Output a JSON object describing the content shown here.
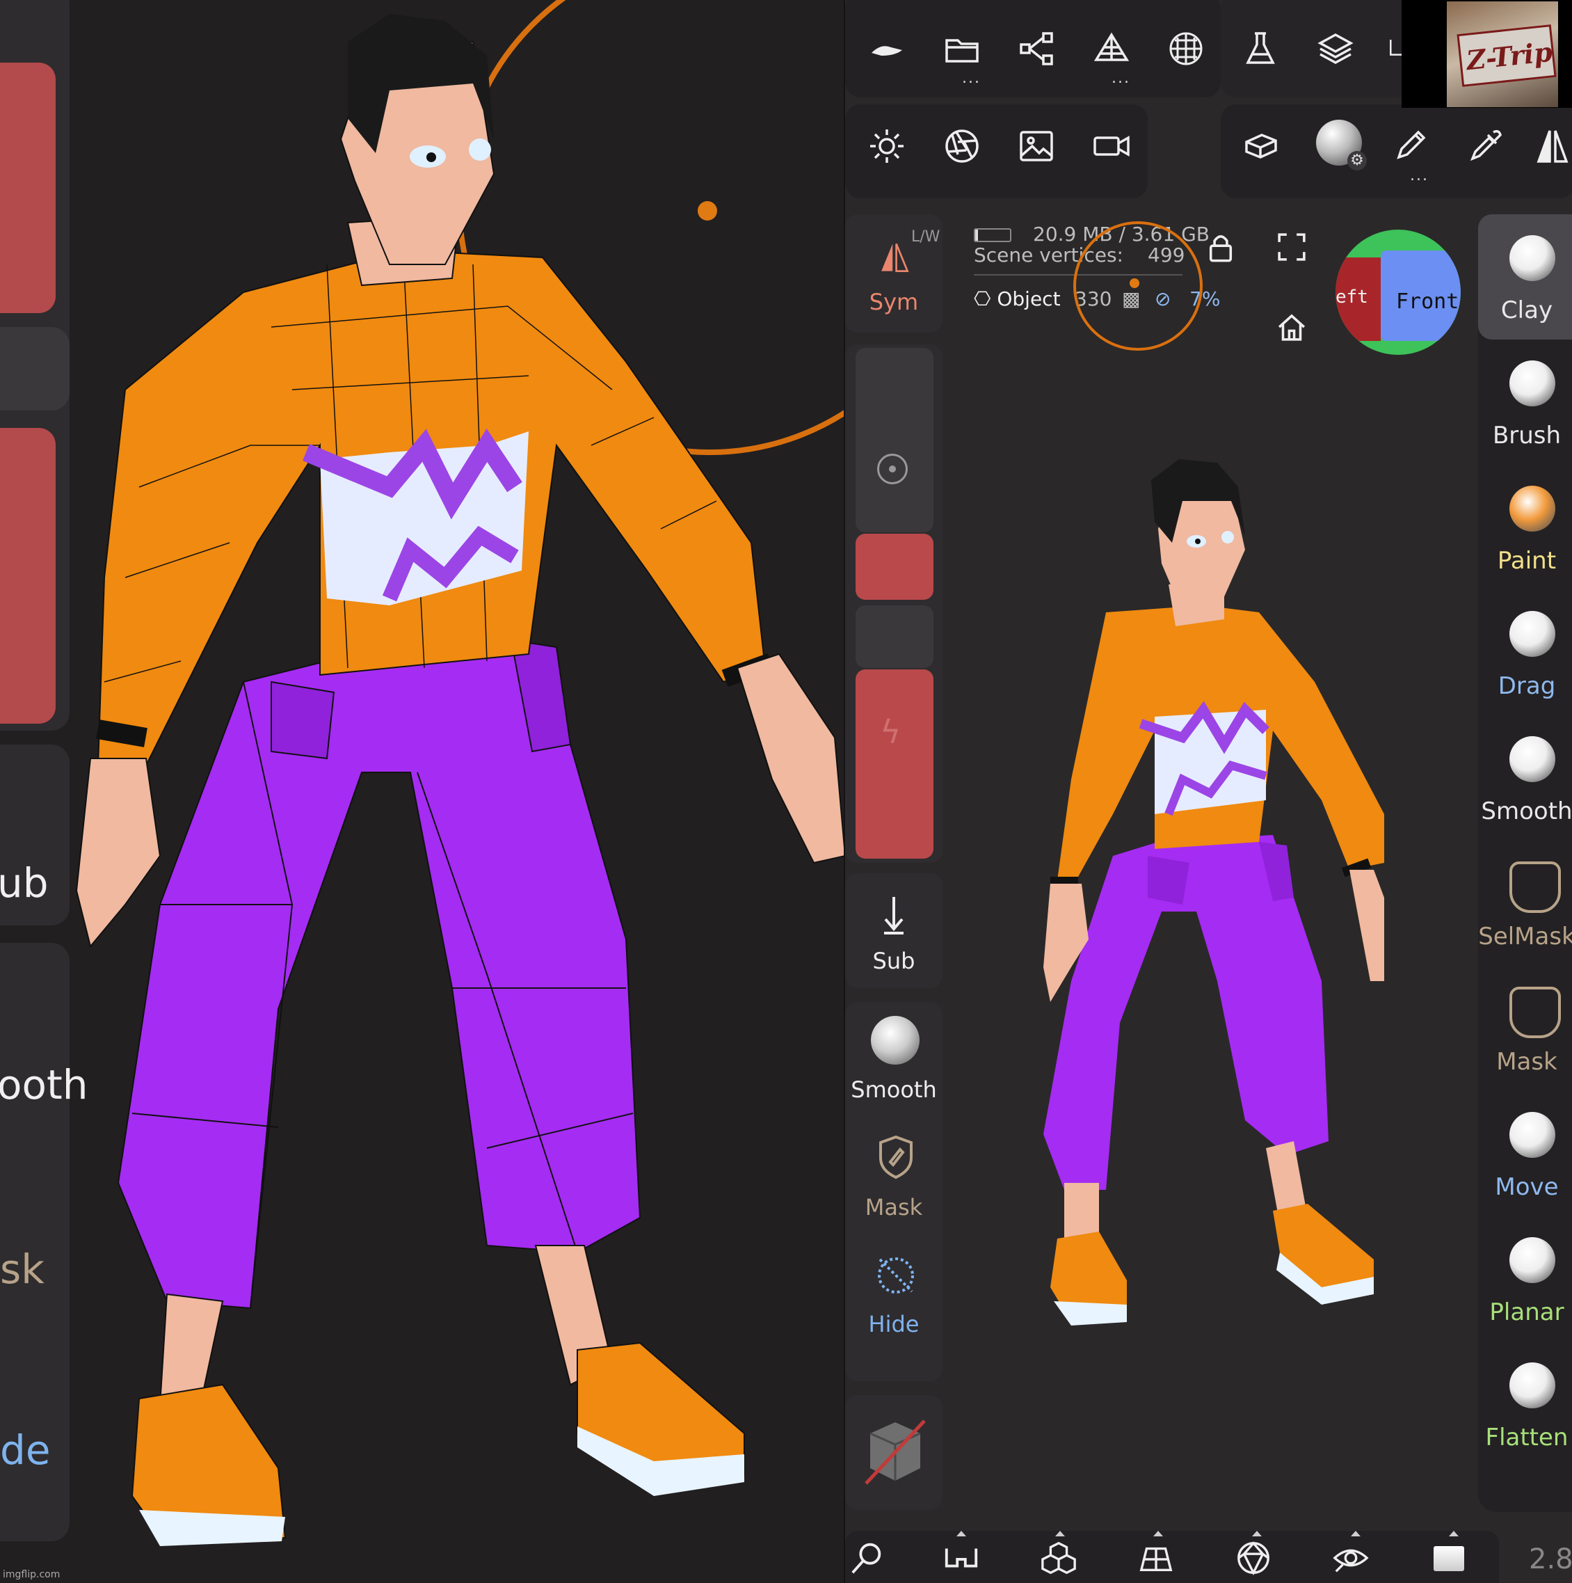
{
  "watermark": "imgflip.com",
  "left_zoom": {
    "labels": {
      "sub": "ub",
      "smooth": "ooth",
      "mask": "sk",
      "hide": "de"
    }
  },
  "toolbar_top": {
    "icons": [
      "hat-icon",
      "folder-icon",
      "scene-tree-icon",
      "topology-icon",
      "sphere-grid-icon",
      "flask-icon",
      "layers-icon",
      "crop-icon"
    ]
  },
  "toolbar_second": {
    "icons": [
      "sun-icon",
      "aperture-icon",
      "image-icon",
      "video-camera-icon",
      "box-flat-icon",
      "matcap-sphere-icon",
      "pencil-icon",
      "eyedropper-icon",
      "symmetry-icon"
    ]
  },
  "album_art": {
    "text": "Z-Trip"
  },
  "hud": {
    "memory": "20.9 MB / 3.61 GB",
    "vertices_label": "Scene vertices:",
    "vertices_value": "499",
    "object_label": "Object",
    "object_faces": "330",
    "percent": "7%"
  },
  "view_cube": {
    "front": "Front",
    "left": "eft"
  },
  "left_tools": {
    "sym_label": "Sym",
    "sym_mode": "L/W",
    "sub_label": "Sub",
    "smooth_label": "Smooth",
    "mask_label": "Mask",
    "hide_label": "Hide"
  },
  "brushes": [
    {
      "name": "Clay",
      "color": "#eeeeee",
      "label_color": "#e8e8e8",
      "active": true
    },
    {
      "name": "Brush",
      "color": "#eeeeee",
      "label_color": "#e8e8e8",
      "active": false
    },
    {
      "name": "Paint",
      "color": "#f29a3c",
      "label_color": "#f2e08a",
      "active": false
    },
    {
      "name": "Drag",
      "color": "#eeeeee",
      "label_color": "#8fb8ee",
      "active": false
    },
    {
      "name": "Smooth",
      "color": "#eeeeee",
      "label_color": "#e8e8e8",
      "active": false
    },
    {
      "name": "SelMask",
      "color": "#b7a389",
      "label_color": "#b7a389",
      "active": false
    },
    {
      "name": "Mask",
      "color": "#b7a389",
      "label_color": "#b7a389",
      "active": false
    },
    {
      "name": "Move",
      "color": "#eeeeee",
      "label_color": "#8fb8ee",
      "active": false
    },
    {
      "name": "Planar",
      "color": "#eeeeee",
      "label_color": "#a8e07a",
      "active": false
    },
    {
      "name": "Flatten",
      "color": "#eeeeee",
      "label_color": "#a8e07a",
      "active": false
    }
  ],
  "bottom_bar": {
    "icons": [
      "search-icon",
      "glasses-icon",
      "cubes-icon",
      "grid-plane-icon",
      "polyhedron-icon",
      "eye-icon",
      "square-swatch-icon"
    ],
    "version": "2.8"
  },
  "colors": {
    "shirt": "#f08a10",
    "pants": "#a52cf3",
    "skin": "#f0b9a0",
    "accent_red": "#b9494b",
    "cursor": "#e07a12"
  }
}
